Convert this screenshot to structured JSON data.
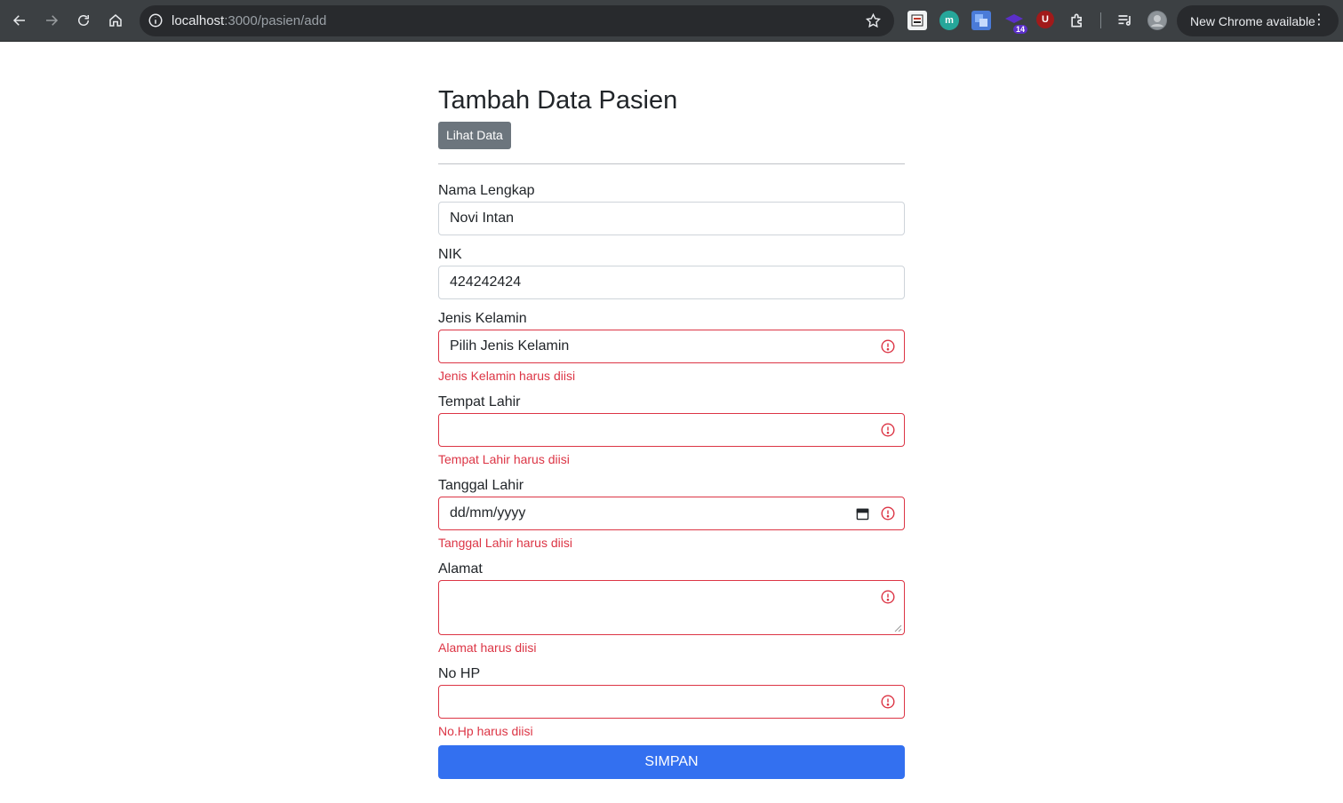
{
  "browser": {
    "url_host": "localhost",
    "url_path": ":3000/pasien/add",
    "extension_badge": "14",
    "extension_m": "m",
    "extension_u": "U",
    "update_label": "New Chrome available"
  },
  "page": {
    "title": "Tambah Data Pasien",
    "view_button": "Lihat Data",
    "submit_button": "SIMPAN"
  },
  "form": {
    "nama": {
      "label": "Nama Lengkap",
      "value": "Novi Intan"
    },
    "nik": {
      "label": "NIK",
      "value": "424242424"
    },
    "jenis_kelamin": {
      "label": "Jenis Kelamin",
      "value": "Pilih Jenis Kelamin",
      "error": "Jenis Kelamin harus diisi"
    },
    "tempat_lahir": {
      "label": "Tempat Lahir",
      "value": "",
      "error": "Tempat Lahir harus diisi"
    },
    "tanggal_lahir": {
      "label": "Tanggal Lahir",
      "value": "dd/mm/yyyy",
      "error": "Tanggal Lahir harus diisi"
    },
    "alamat": {
      "label": "Alamat",
      "value": "",
      "error": "Alamat harus diisi"
    },
    "no_hp": {
      "label": "No HP",
      "value": "",
      "error": "No.Hp harus diisi"
    }
  },
  "colors": {
    "error": "#dc3545",
    "primary": "#3370f0",
    "secondary": "#6c757d"
  }
}
